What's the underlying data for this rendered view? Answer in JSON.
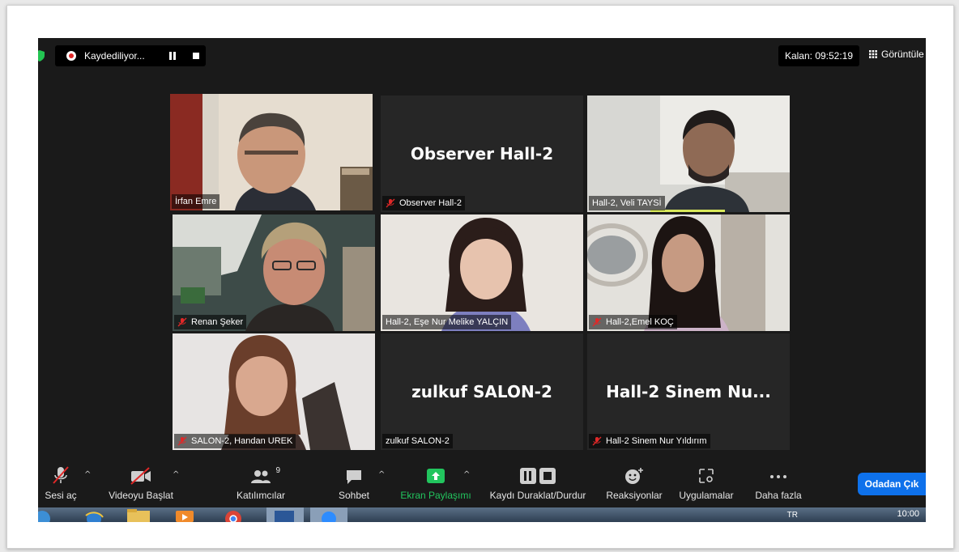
{
  "topbar": {
    "recording_label": "Kaydediliyor...",
    "remaining": "Kalan: 09:52:19",
    "view_label": "Görüntüle"
  },
  "tiles": [
    {
      "name": "İrfan Emre",
      "muted": false,
      "video": true,
      "active": true
    },
    {
      "name": "Observer Hall-2",
      "big_name": "Observer Hall-2",
      "muted": true,
      "video": false
    },
    {
      "name": "Hall-2, Veli TAYSİ",
      "muted": false,
      "video": true
    },
    {
      "name": "Renan Şeker",
      "muted": true,
      "video": true
    },
    {
      "name": "Hall-2, Eşe Nur Melike YALÇIN",
      "muted": false,
      "video": true
    },
    {
      "name": "Hall-2,Emel KOÇ",
      "muted": true,
      "video": true
    },
    {
      "name": "SALON-2, Handan UREK",
      "muted": true,
      "video": true
    },
    {
      "name": "zulkuf SALON-2",
      "big_name": "zulkuf SALON-2",
      "muted": false,
      "video": false
    },
    {
      "name": "Hall-2 Sinem Nur Yıldırım",
      "big_name": "Hall-2 Sinem Nu...",
      "muted": true,
      "video": false
    }
  ],
  "toolbar": {
    "unmute": "Sesi aç",
    "start_video": "Videoyu Başlat",
    "participants": "Katılımcılar",
    "participants_count": "9",
    "chat": "Sohbet",
    "share_screen": "Ekran Paylaşımı",
    "pause_stop_recording": "Kaydı Duraklat/Durdur",
    "reactions": "Reaksiyonlar",
    "apps": "Uygulamalar",
    "more": "Daha fazla",
    "leave": "Odadan Çık"
  },
  "taskbar": {
    "language": "TR",
    "time": "10:00"
  },
  "colors": {
    "active_speaker": "#c9e24a",
    "share_green": "#22c55e",
    "leave_blue": "#0e71eb",
    "mute_red": "#e02828"
  }
}
